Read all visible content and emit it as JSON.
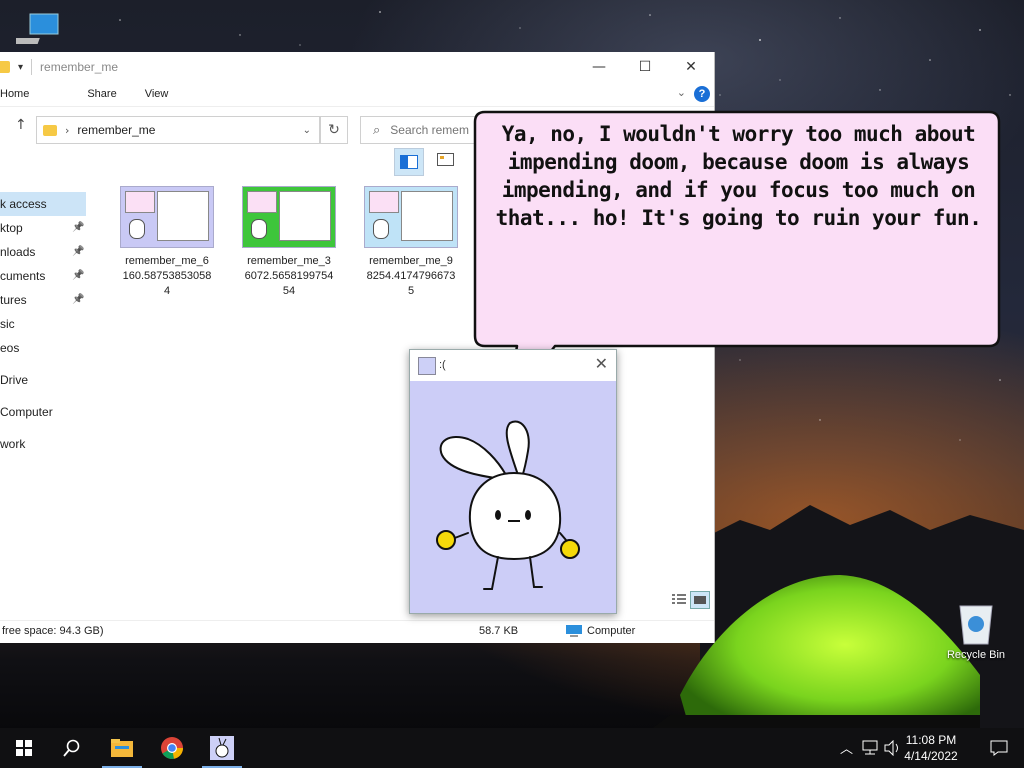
{
  "desktop": {
    "recycle_bin_label": "Recycle Bin"
  },
  "explorer": {
    "title": "remember_me",
    "ribbon_tabs": [
      "Home",
      "Share",
      "View"
    ],
    "address_path": "remember_me",
    "search_placeholder": "Search remem",
    "nav_items": [
      {
        "label": "k access",
        "pinned": false,
        "selected": true
      },
      {
        "label": "ktop",
        "pinned": true
      },
      {
        "label": "nloads",
        "pinned": true
      },
      {
        "label": "cuments",
        "pinned": true
      },
      {
        "label": "tures",
        "pinned": true
      },
      {
        "label": "sic",
        "pinned": false
      },
      {
        "label": "eos",
        "pinned": false
      },
      {
        "label": "Drive",
        "pinned": false
      },
      {
        "label": "Computer",
        "pinned": false
      },
      {
        "label": "work",
        "pinned": false
      }
    ],
    "files": [
      {
        "name_lines": [
          "remember_me_6",
          "160.58753853058",
          "4"
        ],
        "thumb_color": "#c9c9f5"
      },
      {
        "name_lines": [
          "remember_me_3",
          "6072.5658199754",
          "54"
        ],
        "thumb_color": "#3ec63b"
      },
      {
        "name_lines": [
          "remember_me_9",
          "8254.4174796673",
          "5"
        ],
        "thumb_color": "#bfe3f7"
      }
    ],
    "status": {
      "free_space": "free space: 94.3 GB)",
      "size": "58.7 KB",
      "location": "Computer"
    }
  },
  "speech_bubble": {
    "lines": [
      "Ya, no, I wouldn't worry too much about",
      "impending doom, because doom is always",
      "impending, and if you focus too much on",
      "that... ho! It's going to ruin your fun."
    ]
  },
  "popup": {
    "title": ":(",
    "bg_color": "#cccdf7"
  },
  "taskbar": {
    "time": "11:08 PM",
    "date": "4/14/2022"
  }
}
